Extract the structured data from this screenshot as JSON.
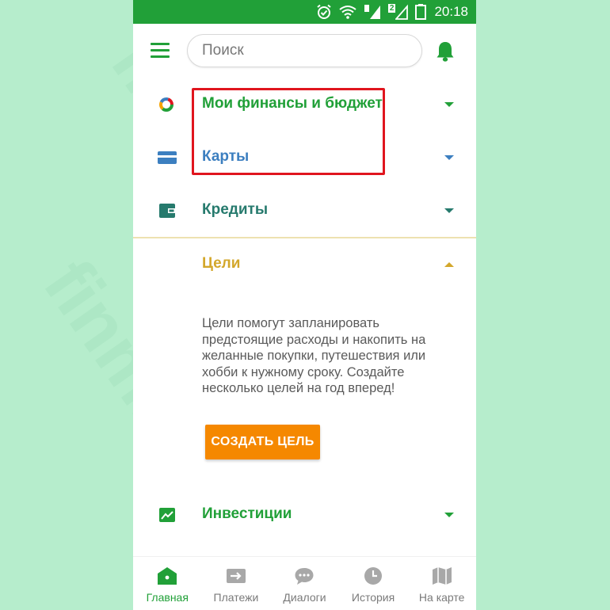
{
  "status_bar": {
    "time": "20:18",
    "sim2_label": "2"
  },
  "search": {
    "placeholder": "Поиск"
  },
  "sections": {
    "finance": {
      "label": "Мои финансы и бюджет"
    },
    "cards": {
      "label": "Карты"
    },
    "credits": {
      "label": "Кредиты"
    },
    "goals": {
      "label": "Цели",
      "description": "Цели помогут запланировать предстоящие расходы и накопить на желанные покупки, путешествия или хобби к нужному сроку. Создайте несколько целей на год вперед!",
      "button_label": "СОЗДАТЬ ЦЕЛЬ"
    },
    "investments": {
      "label": "Инвестиции"
    }
  },
  "bottom_nav": [
    {
      "label": "Главная",
      "icon": "home-icon",
      "active": true
    },
    {
      "label": "Платежи",
      "icon": "transfer-arrow-icon",
      "active": false
    },
    {
      "label": "Диалоги",
      "icon": "chat-bubble-icon",
      "active": false
    },
    {
      "label": "История",
      "icon": "clock-icon",
      "active": false
    },
    {
      "label": "На карте",
      "icon": "map-icon",
      "active": false
    }
  ],
  "watermark": "finmru.com",
  "colors": {
    "brand_green": "#21a038",
    "cards_blue": "#3c7fc0",
    "credits_teal": "#267a6d",
    "goals_gold": "#d3a72b",
    "button_orange": "#f58800",
    "highlight_red": "#e0151e",
    "background_mint": "#b6edcc"
  }
}
